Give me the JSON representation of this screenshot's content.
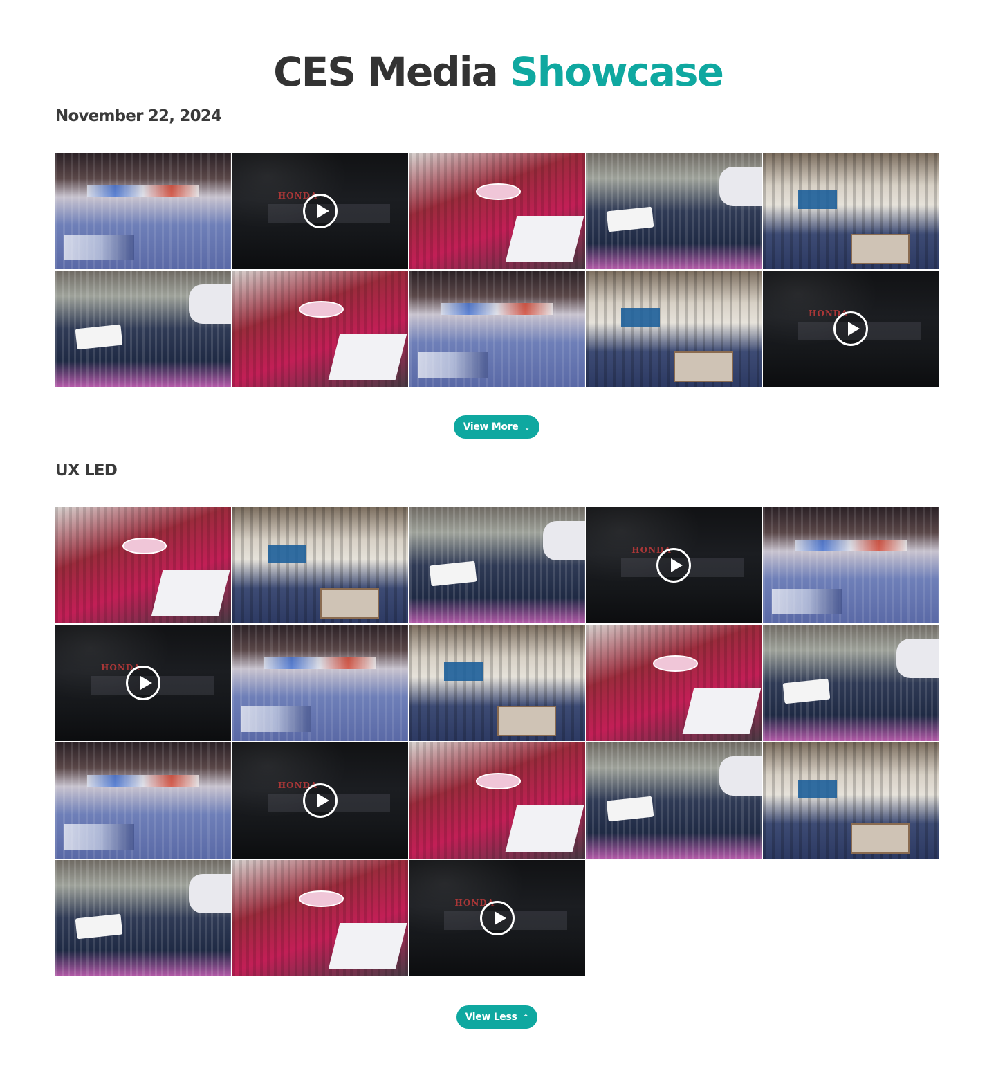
{
  "header": {
    "title_main": "CES Media",
    "title_accent": "Showcase"
  },
  "colors": {
    "accent": "#0fa8a0",
    "heading": "#333333"
  },
  "sections": [
    {
      "title": "November 22, 2024",
      "tiles": [
        "photo",
        "video",
        "photo",
        "photo",
        "photo",
        "photo",
        "photo",
        "photo",
        "photo",
        "video"
      ],
      "button": {
        "label": "View More",
        "icon": "chevron-down-icon",
        "glyph": "⌄"
      }
    },
    {
      "title": "UX LED",
      "tiles": [
        "photo",
        "photo",
        "photo",
        "video",
        "photo",
        "video",
        "photo",
        "photo",
        "photo",
        "photo",
        "photo",
        "video",
        "photo",
        "photo",
        "photo",
        "photo",
        "photo",
        "video"
      ],
      "button": {
        "label": "View Less",
        "icon": "chevron-up-icon",
        "glyph": "⌃"
      }
    }
  ]
}
